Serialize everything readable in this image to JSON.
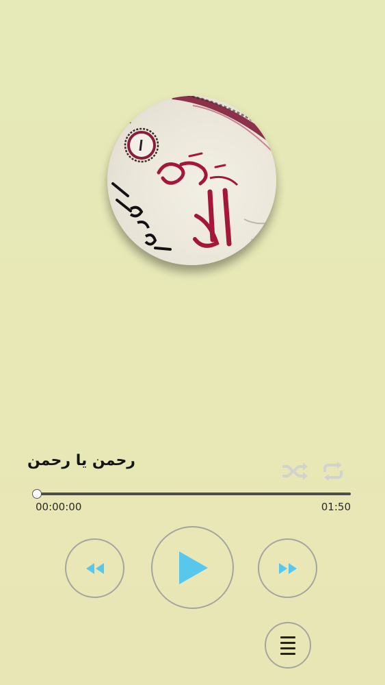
{
  "player": {
    "track_title": "رحمن يا رحمن",
    "current_time": "00:00:00",
    "total_time": "01:50",
    "progress": 0
  },
  "icons": {
    "album_art": "album-art-quran-calligraphy",
    "shuffle": "shuffle-icon",
    "repeat": "repeat-icon",
    "rewind": "rewind-icon",
    "play": "play-icon",
    "forward": "fast-forward-icon",
    "playlist": "playlist-menu-icon"
  },
  "colors": {
    "accent": "#58c7ee",
    "button_border": "#a5a5a0",
    "mode_icon": "#d2d3cc",
    "background": "#e6e8b6",
    "calligraphy": "#a4163a"
  }
}
